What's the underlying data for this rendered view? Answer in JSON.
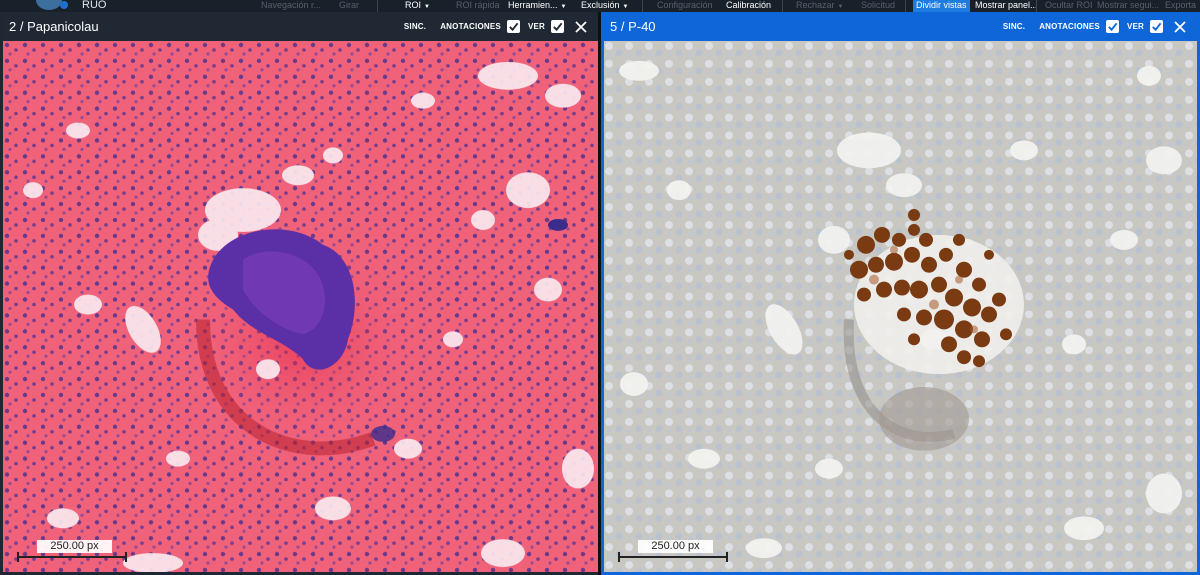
{
  "app": {
    "name": "RUO"
  },
  "toolbar": {
    "items": [
      {
        "label": "Navegación r...",
        "state": "disabled",
        "caret": false
      },
      {
        "label": "Girar",
        "state": "disabled",
        "caret": false
      },
      {
        "label": "ROI",
        "state": "active",
        "caret": true
      },
      {
        "label": "ROI rápida",
        "state": "disabled",
        "caret": false
      },
      {
        "label": "Herramien...",
        "state": "active",
        "caret": true
      },
      {
        "label": "Exclusión",
        "state": "active",
        "caret": true
      },
      {
        "label": "Configuración",
        "state": "disabled",
        "caret": false
      },
      {
        "label": "Calibración",
        "state": "active",
        "caret": false
      },
      {
        "label": "Rechazar",
        "state": "disabled",
        "caret": true
      },
      {
        "label": "Solicitud",
        "state": "disabled",
        "caret": false
      },
      {
        "label": "Dividir vistas",
        "state": "highlight",
        "caret": false
      },
      {
        "label": "Mostrar panel...",
        "state": "active",
        "caret": false
      },
      {
        "label": "Ocultar ROI",
        "state": "disabled",
        "caret": false
      },
      {
        "label": "Mostrar segui...",
        "state": "disabled",
        "caret": false
      },
      {
        "label": "Exporta",
        "state": "disabled",
        "caret": false
      }
    ]
  },
  "panels": {
    "left": {
      "title": "2 / Papanicolau",
      "sync_label": "SINC.",
      "annotations_label": "ANOTACIONES",
      "annotations_checked": true,
      "view_label": "VER",
      "view_checked": true,
      "scale_label": "250.00 px",
      "stain_colors": {
        "background": "#f0627a",
        "cells": "#3b2c8c",
        "cluster": "#5b2fa6"
      }
    },
    "right": {
      "title": "5 / P-40",
      "sync_label": "SINC.",
      "annotations_label": "ANOTACIONES",
      "annotations_checked": true,
      "view_label": "VER",
      "view_checked": true,
      "scale_label": "250.00 px",
      "stain_colors": {
        "background": "#c9c7c2",
        "cells": "#a9bcd4",
        "nuclei": "#7a3a12"
      }
    }
  },
  "colors": {
    "accent": "#0f66d9",
    "toolbar_bg": "#18202a",
    "highlight": "#1e7be0"
  },
  "icons": {
    "checkbox": "checkmark-icon",
    "close": "close-x-icon"
  }
}
